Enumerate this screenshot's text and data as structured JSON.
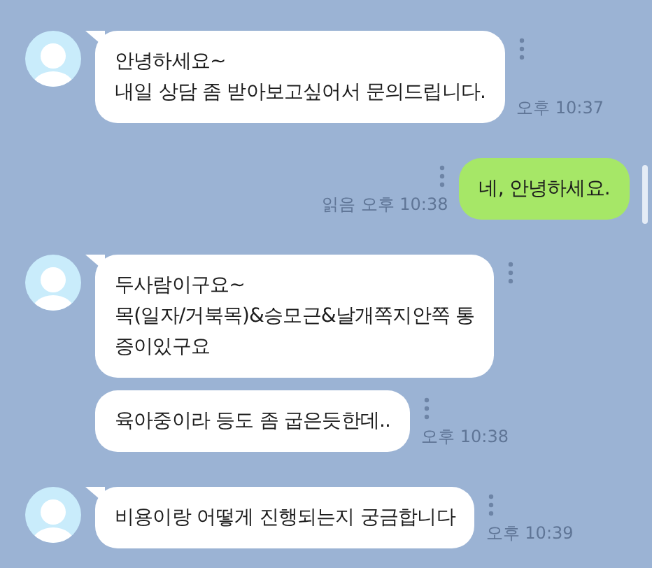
{
  "messages": [
    {
      "kind": "incoming",
      "show_avatar": true,
      "text": "안녕하세요~\n내일 상담 좀 받아보고싶어서 문의드립니다.",
      "time": "오후 10:37"
    },
    {
      "kind": "outgoing",
      "show_avatar": false,
      "text": "네, 안녕하세요.",
      "receipt": "읽음",
      "time": "오후 10:38"
    },
    {
      "kind": "incoming",
      "show_avatar": true,
      "text": "두사람이구요~\n목(일자/거북목)&승모근&날개쪽지안쪽 통\n증이있구요"
    },
    {
      "kind": "incoming",
      "show_avatar": false,
      "text": "육아중이라 등도 좀 굽은듯한데..",
      "time": "오후 10:38"
    },
    {
      "kind": "incoming",
      "show_avatar": true,
      "text": "비용이랑 어떻게 진행되는지 궁금합니다",
      "time": "오후 10:39"
    }
  ]
}
